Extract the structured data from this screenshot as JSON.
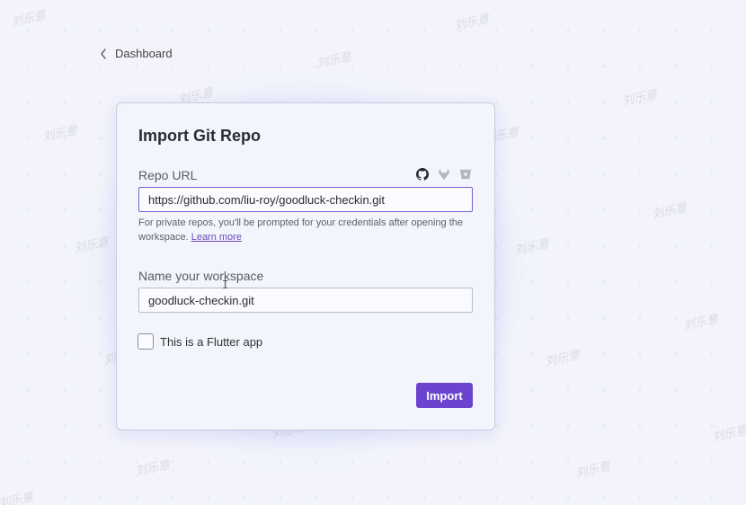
{
  "nav": {
    "back_label": "Dashboard"
  },
  "dialog": {
    "title": "Import Git Repo",
    "repo_url": {
      "label": "Repo URL",
      "value": "https://github.com/liu-roy/goodluck-checkin.git",
      "help_text": "For private repos, you'll be prompted for your credentials after opening the workspace.",
      "help_link": "Learn more"
    },
    "providers": [
      "github-icon",
      "gitlab-icon",
      "bitbucket-icon"
    ],
    "workspace_name": {
      "label": "Name your workspace",
      "value": "goodluck-checkin.git"
    },
    "flutter_checkbox": {
      "label": "This is a Flutter app",
      "checked": false
    },
    "import_button": "Import"
  },
  "watermark_text": "刘乐意",
  "colors": {
    "accent": "#6b43cf",
    "background": "#f3f4fb",
    "dialog": "#f3f5fc"
  }
}
